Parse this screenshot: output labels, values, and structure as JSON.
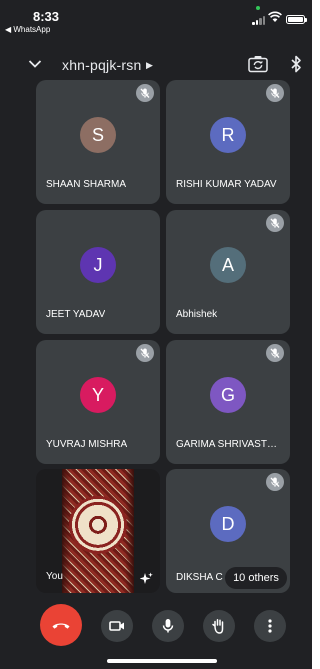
{
  "status_bar": {
    "time": "8:33",
    "back_app": "◀ WhatsApp",
    "camera_dot_color": "#33c759",
    "icons": [
      "signal-icon",
      "wifi-icon",
      "battery-icon"
    ]
  },
  "header": {
    "meeting_code": "xhn-pqjk-rsn",
    "icons": [
      "chevron-down-icon",
      "meeting-info-caret-icon",
      "flip-camera-icon",
      "bluetooth-icon"
    ]
  },
  "participants": [
    {
      "name": "SHAAN SHARMA",
      "initial": "S",
      "avatar_color": "#8d6e63",
      "muted": true
    },
    {
      "name": "RISHI KUMAR YADAV",
      "initial": "R",
      "avatar_color": "#5c6bc0",
      "muted": true
    },
    {
      "name": "JEET YADAV",
      "initial": "J",
      "avatar_color": "#5e35b1",
      "muted": false
    },
    {
      "name": "Abhishek",
      "initial": "A",
      "avatar_color": "#546e7a",
      "muted": true
    },
    {
      "name": "YUVRAJ MISHRA",
      "initial": "Y",
      "avatar_color": "#d81b60",
      "muted": true
    },
    {
      "name": "GARIMA SHRIVAST…",
      "initial": "G",
      "avatar_color": "#7e57c2",
      "muted": true
    },
    {
      "name": "DIKSHA C",
      "initial": "D",
      "avatar_color": "#5c6bc0",
      "muted": true
    }
  ],
  "self_tile": {
    "label": "You",
    "icon": "visual-effects-sparkle-icon"
  },
  "others_badge": "10 others",
  "controls": {
    "end_call_color": "#ea4335",
    "items": [
      "end-call-icon",
      "camera-icon",
      "microphone-icon",
      "raise-hand-icon",
      "more-options-icon"
    ]
  },
  "colors": {
    "background": "#202124",
    "tile": "#3c4043",
    "mute_badge": "#9aa0a6"
  }
}
